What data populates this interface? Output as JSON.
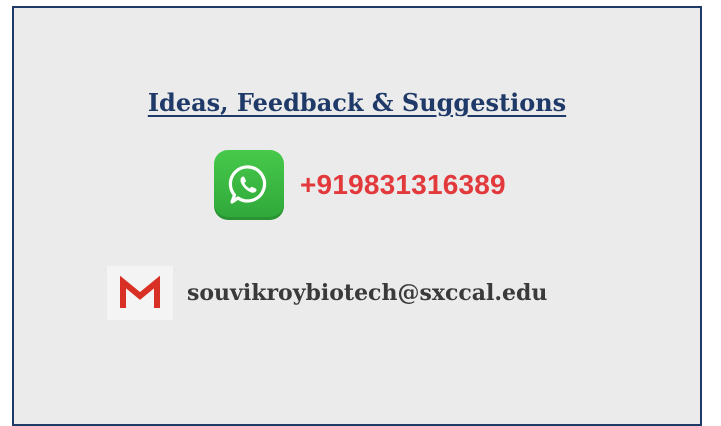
{
  "card": {
    "title": "Ideas, Feedback & Suggestions",
    "phone": "+919831316389",
    "email": "souvikroybiotech@sxccal.edu",
    "phone_icon": "whatsapp-icon",
    "email_icon": "gmail-icon"
  },
  "colors": {
    "border": "#1f3a68",
    "title": "#1f3a68",
    "phone": "#e23a3c",
    "email": "#3a3a3a",
    "background": "#ebebeb",
    "whatsapp_green": "#3cb843",
    "gmail_red": "#d93025"
  }
}
